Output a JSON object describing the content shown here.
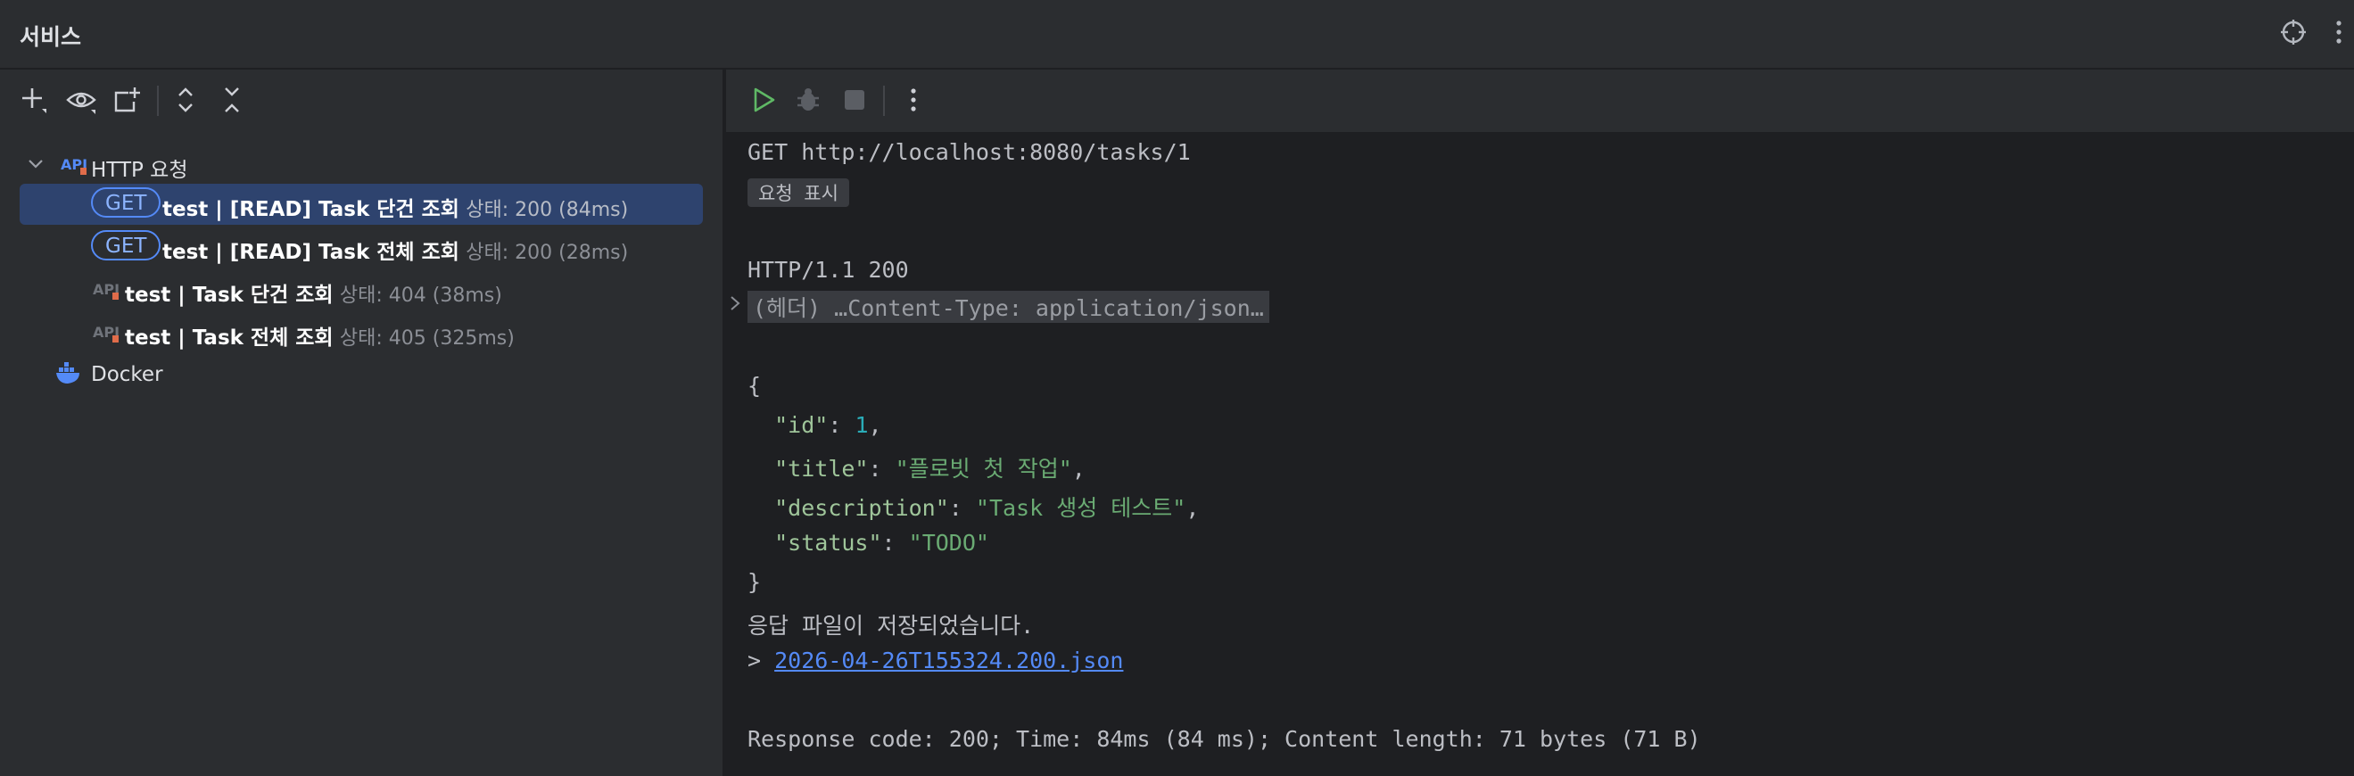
{
  "titlebar": {
    "title": "서비스",
    "icons": [
      "crosshair-icon",
      "more-vertical-icon"
    ]
  },
  "left_toolbar": {
    "icons": [
      "add-icon",
      "eye-icon",
      "new-tab-icon",
      "expand-all-icon",
      "collapse-all-icon"
    ]
  },
  "tree": {
    "group_label": "HTTP 요청",
    "requests": [
      {
        "method": "GET",
        "name": "test  |  [READ] Task 단건 조회",
        "status": "상태: 200 (84ms)"
      },
      {
        "method": "GET",
        "name": "test  |  [READ] Task 전체 조회",
        "status": "상태: 200 (28ms)"
      },
      {
        "method": "",
        "name": "test | Task 단건 조회",
        "status": "상태: 404 (38ms)"
      },
      {
        "method": "",
        "name": "test | Task 전체 조회",
        "status": "상태: 405 (325ms)"
      }
    ],
    "docker_label": "Docker"
  },
  "right_toolbar": {
    "icons": [
      "run-icon",
      "debug-icon",
      "stop-icon",
      "more-vertical-icon"
    ]
  },
  "console": {
    "request_line": "GET http://localhost:8080/tasks/1",
    "show_request_chip": "요청 표시",
    "status_line": "HTTP/1.1 200",
    "headers_fold": "(헤더) …Content-Type: application/json…",
    "brace_open": "{",
    "json": {
      "id_key": "\"id\"",
      "id_val": "1",
      "title_key": "\"title\"",
      "title_val": "\"플로빗 첫 작업\"",
      "description_key": "\"description\"",
      "description_val": "\"Task 생성 테스트\"",
      "status_key": "\"status\"",
      "status_val": "\"TODO\""
    },
    "brace_close": "}",
    "saved_message": "응답 파일이 저장되었습니다.",
    "saved_prefix": "> ",
    "saved_file": "2026-04-26T155324.200.json",
    "summary": "Response code: 200; Time: 84ms (84 ms); Content length: 71 bytes (71 B)"
  },
  "colors": {
    "accent": "#548af7",
    "selection": "#2e436e",
    "json_string": "#6aab73",
    "json_number": "#2aacb8"
  }
}
